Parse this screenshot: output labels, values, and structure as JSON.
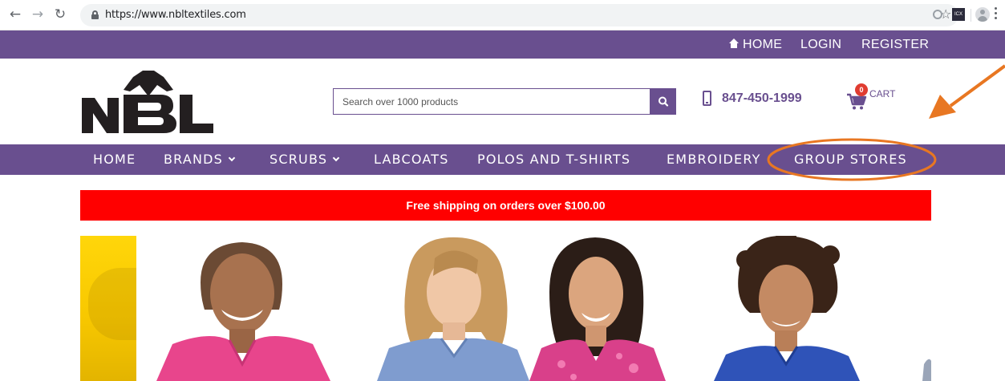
{
  "browser": {
    "url": "https://www.nbltextiles.com",
    "back_icon": "arrow-left-icon",
    "forward_icon": "arrow-right-icon",
    "reload_icon": "reload-icon",
    "lock_icon": "lock-icon",
    "bookmark_icon": "star-icon"
  },
  "topbar": {
    "home": "HOME",
    "login": "LOGIN",
    "register": "REGISTER"
  },
  "header": {
    "logo_text": "NBL",
    "search_placeholder": "Search over 1000 products",
    "phone": "847-450-1999",
    "cart_label": "CART",
    "cart_count": "0"
  },
  "nav": {
    "items": [
      {
        "label": "HOME",
        "has_dropdown": false
      },
      {
        "label": "BRANDS",
        "has_dropdown": true
      },
      {
        "label": "SCRUBS",
        "has_dropdown": true
      },
      {
        "label": "LABCOATS",
        "has_dropdown": false
      },
      {
        "label": "POLOS AND T-SHIRTS",
        "has_dropdown": false
      },
      {
        "label": "EMBROIDERY",
        "has_dropdown": false
      },
      {
        "label": "GROUP STORES",
        "has_dropdown": false
      }
    ]
  },
  "promo": {
    "text": "Free shipping on orders over $100.00"
  },
  "banner": {
    "images": [
      "model-pink-scrub",
      "model-blue-scrub",
      "model-pink-print-scrub",
      "model-royal-blue-scrub"
    ]
  },
  "colors": {
    "brand_purple": "#694f8f",
    "promo_red": "#ff0000",
    "annotation_orange": "#e87722"
  }
}
